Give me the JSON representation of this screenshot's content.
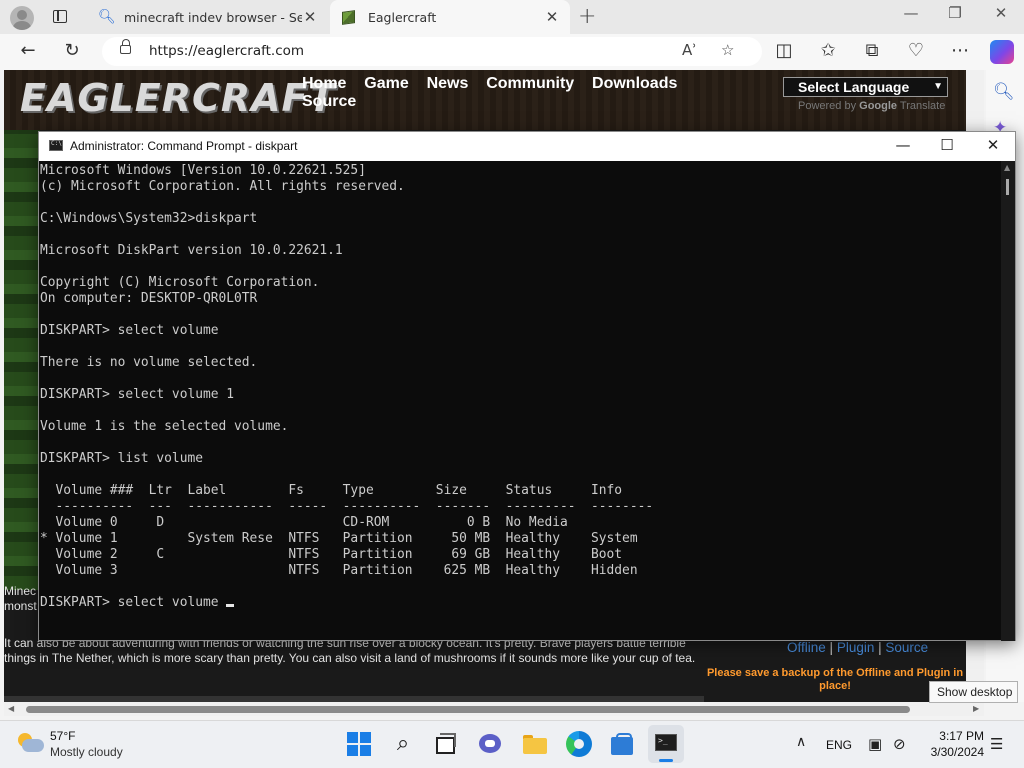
{
  "browser": {
    "tabs": [
      {
        "label": "minecraft indev browser - Search",
        "icon": "search-icon"
      },
      {
        "label": "Eaglercraft",
        "icon": "minecraft-cube-icon"
      }
    ],
    "url": "https://eaglercraft.com"
  },
  "site": {
    "logo": "EAGLERCRAFT",
    "nav": [
      "Home",
      "Game",
      "News",
      "Community",
      "Downloads",
      "Source"
    ],
    "language_select": "Select Language",
    "powered_by": "Powered by",
    "google": "Google",
    "translate": "Translate",
    "side_text": [
      "Minec",
      "monst"
    ],
    "body_text": "It can also be about adventuring with friends or watching the sun rise over a blocky ocean. It's pretty. Brave players battle terrible things in The Nether, which is more scary than pretty. You can also visit a land of mushrooms if it sounds more like your cup of tea.",
    "links": [
      "Offline",
      "Plugin",
      "Source"
    ],
    "link_separator": "|",
    "backup_note": "Please save a backup of the Offline and Plugin in place!"
  },
  "cmd": {
    "title": "Administrator: Command Prompt - diskpart",
    "lines": [
      "Microsoft Windows [Version 10.0.22621.525]",
      "(c) Microsoft Corporation. All rights reserved.",
      "",
      "C:\\Windows\\System32>diskpart",
      "",
      "Microsoft DiskPart version 10.0.22621.1",
      "",
      "Copyright (C) Microsoft Corporation.",
      "On computer: DESKTOP-QR0L0TR",
      "",
      "DISKPART> select volume",
      "",
      "There is no volume selected.",
      "",
      "DISKPART> select volume 1",
      "",
      "Volume 1 is the selected volume.",
      "",
      "DISKPART> list volume",
      "",
      "  Volume ###  Ltr  Label        Fs     Type        Size     Status     Info",
      "  ----------  ---  -----------  -----  ----------  -------  ---------  --------",
      "  Volume 0     D                       CD-ROM          0 B  No Media",
      "* Volume 1         System Rese  NTFS   Partition     50 MB  Healthy    System",
      "  Volume 2     C                NTFS   Partition     69 GB  Healthy    Boot",
      "  Volume 3                      NTFS   Partition    625 MB  Healthy    Hidden",
      ""
    ],
    "prompt": "DISKPART> select volume "
  },
  "tooltip": "Show desktop",
  "taskbar": {
    "temperature": "57°F",
    "weather": "Mostly cloudy",
    "language": "ENG",
    "time": "3:17 PM",
    "date": "3/30/2024"
  }
}
